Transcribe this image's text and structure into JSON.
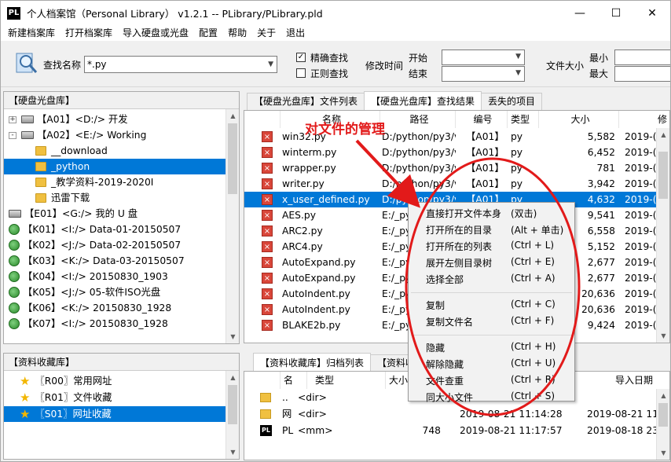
{
  "window": {
    "title": "个人档案馆（Personal Library） v1.2.1 -- PLibrary/PLibrary.pld",
    "app_icon_text": "PL",
    "minimize": "—",
    "maximize": "☐",
    "close": "✕"
  },
  "menu": [
    "新建档案库",
    "打开档案库",
    "导入硬盘或光盘",
    "配置",
    "帮助",
    "关于",
    "退出"
  ],
  "toolbar": {
    "search_label": "查找名称",
    "search_value": "*.py",
    "exact_label": "精确查找",
    "exact_checked": true,
    "regex_label": "正则查找",
    "regex_checked": false,
    "mtime_label": "修改时间",
    "start_label": "开始",
    "end_label": "结束",
    "size_label": "文件大小",
    "min_label": "最小",
    "max_label": "最大"
  },
  "disk_panel": {
    "header": "【硬盘光盘库】",
    "items": [
      {
        "label": "【A01】<D:/> 开发",
        "type": "drive",
        "expander": "+"
      },
      {
        "label": "【A02】<E:/> Working",
        "type": "drive",
        "expander": "-"
      },
      {
        "label": "__download",
        "type": "folder"
      },
      {
        "label": "_python",
        "type": "folder",
        "selected": true
      },
      {
        "label": "_教学资料-2019-2020I",
        "type": "folder"
      },
      {
        "label": "迅雷下载",
        "type": "folder"
      },
      {
        "label": "【E01】<G:/> 我的 U 盘",
        "type": "drive"
      },
      {
        "label": "【K01】<I:/> Data-01-20150507",
        "type": "globe"
      },
      {
        "label": "【K02】<J:/> Data-02-20150507",
        "type": "globe"
      },
      {
        "label": "【K03】<K:/> Data-03-20150507",
        "type": "globe"
      },
      {
        "label": "【K04】<I:/> 20150830_1903",
        "type": "globe"
      },
      {
        "label": "【K05】<J:/> 05-软件ISO光盘",
        "type": "globe"
      },
      {
        "label": "【K06】<K:/> 20150830_1928",
        "type": "globe"
      },
      {
        "label": "【K07】<I:/> 20150830_1928",
        "type": "globe"
      }
    ]
  },
  "fav_panel": {
    "header": "【资料收藏库】",
    "items": [
      {
        "label": "〖R00〗常用网址"
      },
      {
        "label": "〖R01〗文件收藏"
      },
      {
        "label": "〖S01〗网址收藏",
        "selected": true
      }
    ]
  },
  "file_tabs": [
    "【硬盘光盘库】文件列表",
    "【硬盘光盘库】查找结果",
    "丢失的项目"
  ],
  "file_columns": [
    "名称",
    "路径",
    "编号",
    "类型",
    "大小",
    "修"
  ],
  "files": [
    {
      "name": "win32.py",
      "path": "D:/python/py3/ve",
      "id": "【A01】",
      "type": "py",
      "size": "5,582",
      "date": "2019-("
    },
    {
      "name": "winterm.py",
      "path": "D:/python/py3/ve",
      "id": "【A01】",
      "type": "py",
      "size": "6,452",
      "date": "2019-("
    },
    {
      "name": "wrapper.py",
      "path": "D:/python/py3/ve",
      "id": "【A01】",
      "type": "py",
      "size": "781",
      "date": "2019-("
    },
    {
      "name": "writer.py",
      "path": "D:/python/py3/ve",
      "id": "【A01】",
      "type": "py",
      "size": "3,942",
      "date": "2019-("
    },
    {
      "name": "x_user_defined.py",
      "path": "D:/python/py3/ve",
      "id": "【A01】",
      "type": "py",
      "size": "4,632",
      "date": "2019-(",
      "selected": true
    },
    {
      "name": "AES.py",
      "path": "E:/_py",
      "id": "",
      "type": "",
      "size": "9,541",
      "date": "2019-("
    },
    {
      "name": "ARC2.py",
      "path": "E:/_py",
      "id": "",
      "type": "",
      "size": "6,558",
      "date": "2019-("
    },
    {
      "name": "ARC4.py",
      "path": "E:/_py",
      "id": "",
      "type": "",
      "size": "5,152",
      "date": "2019-("
    },
    {
      "name": "AutoExpand.py",
      "path": "E:/_py",
      "id": "",
      "type": "",
      "size": "2,677",
      "date": "2019-("
    },
    {
      "name": "AutoExpand.py",
      "path": "E:/_py",
      "id": "",
      "type": "",
      "size": "2,677",
      "date": "2019-("
    },
    {
      "name": "AutoIndent.py",
      "path": "E:/_py",
      "id": "",
      "type": "",
      "size": "20,636",
      "date": "2019-("
    },
    {
      "name": "AutoIndent.py",
      "path": "E:/_py",
      "id": "",
      "type": "",
      "size": "20,636",
      "date": "2019-("
    },
    {
      "name": "BLAKE2b.py",
      "path": "E:/_py",
      "id": "",
      "type": "",
      "size": "9,424",
      "date": "2019-("
    }
  ],
  "archive_tabs": [
    "【资料收藏库】归档列表",
    "【资料收"
  ],
  "archive_columns": [
    "名",
    "类型",
    "大小",
    "",
    "导入日期"
  ],
  "archives": [
    {
      "name": "..",
      "type": "<dir>",
      "size": "",
      "date1": "",
      "date2": "",
      "icon": "folder-up"
    },
    {
      "name": "网",
      "type": "<dir>",
      "size": "",
      "date1": "2019-08-21 11:14:28",
      "date2": "2019-08-21 11:",
      "icon": "folder"
    },
    {
      "name": "PL",
      "type": "<mm>",
      "size": "748",
      "date1": "2019-08-21 11:17:57",
      "date2": "2019-08-18 23:",
      "icon": "pl"
    }
  ],
  "context_menu": {
    "groups": [
      [
        {
          "label": "直接打开文件本身",
          "shortcut": "(双击)"
        },
        {
          "label": "打开所在的目录",
          "shortcut": "(Alt + 单击)"
        },
        {
          "label": "打开所在的列表",
          "shortcut": "(Ctrl + L)"
        },
        {
          "label": "展开左侧目录树",
          "shortcut": "(Ctrl + E)"
        },
        {
          "label": "选择全部",
          "shortcut": "(Ctrl + A)"
        }
      ],
      [
        {
          "label": "复制",
          "shortcut": "(Ctrl + C)"
        },
        {
          "label": "复制文件名",
          "shortcut": "(Ctrl + F)"
        }
      ],
      [
        {
          "label": "隐藏",
          "shortcut": "(Ctrl + H)"
        },
        {
          "label": "解除隐藏",
          "shortcut": "(Ctrl + U)"
        },
        {
          "label": "文件查重",
          "shortcut": "(Ctrl + R)"
        },
        {
          "label": "同大小文件",
          "shortcut": "(Ctrl + S)"
        }
      ]
    ]
  },
  "annotation": {
    "text": "对文件的管理",
    "color": "#e21a1a"
  },
  "colors": {
    "selection": "#0078d7",
    "accent_red": "#e21a1a"
  }
}
